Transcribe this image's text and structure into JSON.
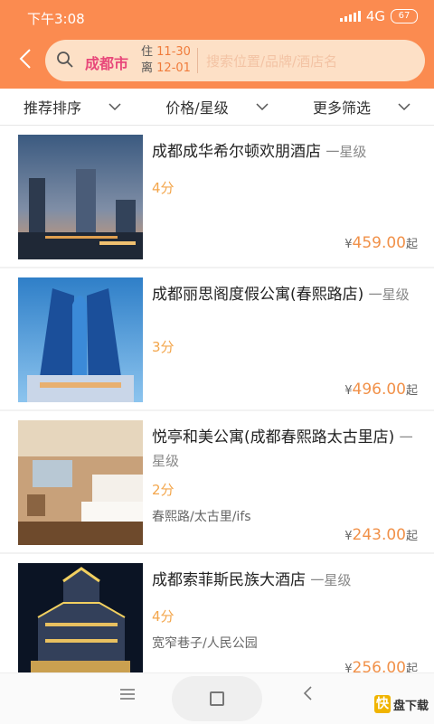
{
  "status_bar": {
    "time": "下午3:08",
    "network": "4G",
    "battery": "67"
  },
  "header": {
    "city": "成都市",
    "checkin_label": "住",
    "checkin_date": "11-30",
    "checkout_label": "离",
    "checkout_date": "12-01",
    "search_placeholder": "搜索位置/品牌/酒店名"
  },
  "filters": [
    {
      "label": "推荐排序"
    },
    {
      "label": "价格/星级"
    },
    {
      "label": "更多筛选"
    }
  ],
  "hotels": [
    {
      "name": "成都成华希尔顿欢朋酒店",
      "star": "一星级",
      "score": "4分",
      "location": "",
      "currency": "¥",
      "price": "459.00",
      "price_suffix": "起"
    },
    {
      "name": "成都丽思阁度假公寓(春熙路店)",
      "star": "一星级",
      "score": "3分",
      "location": "",
      "currency": "¥",
      "price": "496.00",
      "price_suffix": "起"
    },
    {
      "name": "悦亭和美公寓(成都春熙路太古里店)",
      "star": "一星级",
      "score": "2分",
      "location": "春熙路/太古里/ifs",
      "currency": "¥",
      "price": "243.00",
      "price_suffix": "起"
    },
    {
      "name": "成都索菲斯民族大酒店",
      "star": "一星级",
      "score": "4分",
      "location": "宽窄巷子/人民公园",
      "currency": "¥",
      "price": "256.00",
      "price_suffix": "起"
    }
  ],
  "watermark": {
    "logo": "快",
    "text": "盘下载"
  },
  "colors": {
    "brand_orange": "#fb8b50",
    "city_pink": "#e8487a",
    "score_orange": "#f3a64c",
    "price_orange": "#f19149"
  }
}
